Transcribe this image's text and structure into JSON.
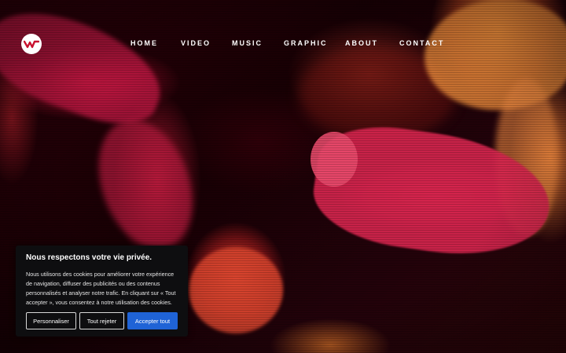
{
  "colors": {
    "accent": "#1f63d6",
    "hero_red": "#d6254e",
    "hero_orange": "#e8893a",
    "banner_bg": "#0e0e10"
  },
  "logo": {
    "icon": "waveform-logo-icon"
  },
  "nav": {
    "items": [
      "HOME",
      "VIDEO",
      "MUSIC",
      "GRAPHIC",
      "ABOUT",
      "CONTACT"
    ]
  },
  "cookie": {
    "title": "Nous respectons votre vie privée.",
    "text": "Nous utilisons des cookies pour améliorer votre expérience de navigation, diffuser des publicités ou des contenus personnalisés et analyser notre trafic. En cliquant sur « Tout accepter », vous consentez à notre utilisation des cookies.",
    "buttons": {
      "customize": "Personnaliser",
      "reject": "Tout rejeter",
      "accept": "Accepter tout"
    }
  }
}
